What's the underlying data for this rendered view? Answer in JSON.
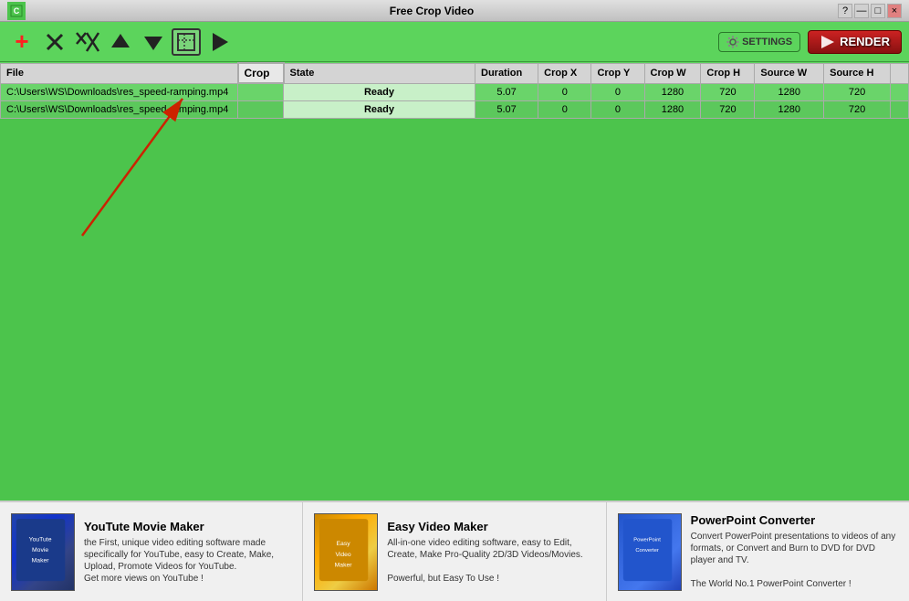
{
  "titleBar": {
    "title": "Free Crop Video",
    "controls": [
      "?",
      "-",
      "□",
      "×"
    ]
  },
  "toolbar": {
    "addBtn": "+",
    "deleteBtn": "✕",
    "deleteAllBtn": "✕✕",
    "upBtn": "↑",
    "downBtn": "↓",
    "cropBtn": "⊡",
    "playBtn": "▶",
    "settingsLabel": "SETTINGS",
    "renderLabel": "RENDER"
  },
  "table": {
    "headers": [
      "File",
      "Crop",
      "State",
      "Duration",
      "Crop X",
      "Crop Y",
      "Crop W",
      "Crop H",
      "Source W",
      "Source H"
    ],
    "rows": [
      {
        "file": "C:\\Users\\WS\\Downloads\\res_speed-ramping.mp4",
        "crop": "",
        "state": "Ready",
        "duration": "5.07",
        "cropX": "0",
        "cropY": "0",
        "cropW": "1280",
        "cropH": "720",
        "sourceW": "1280",
        "sourceH": "720"
      },
      {
        "file": "C:\\Users\\WS\\Downloads\\res_speed-ramping.mp4",
        "crop": "",
        "state": "Ready",
        "duration": "5.07",
        "cropX": "0",
        "cropY": "0",
        "cropW": "1280",
        "cropH": "720",
        "sourceW": "1280",
        "sourceH": "720"
      }
    ]
  },
  "ads": [
    {
      "title": "YouTute Movie Maker",
      "desc": "the First, unique video editing software made specifically for YouTube, easy to Create, Make, Upload, Promote Videos for YouTube.\nGet more views on YouTube !",
      "thumbColor": "yt"
    },
    {
      "title": "Easy Video Maker",
      "desc": "All-in-one video editing software, easy to Edit, Create, Make Pro-Quality 2D/3D Videos/Movies.\n\nPowerful, but Easy To Use !",
      "thumbColor": "ev"
    },
    {
      "title": "PowerPoint Converter",
      "desc": "Convert PowerPoint presentations to videos of any formats, or Convert and Burn to DVD for DVD player and TV.\n\nThe World No.1 PowerPoint Converter !",
      "thumbColor": "pp"
    }
  ]
}
